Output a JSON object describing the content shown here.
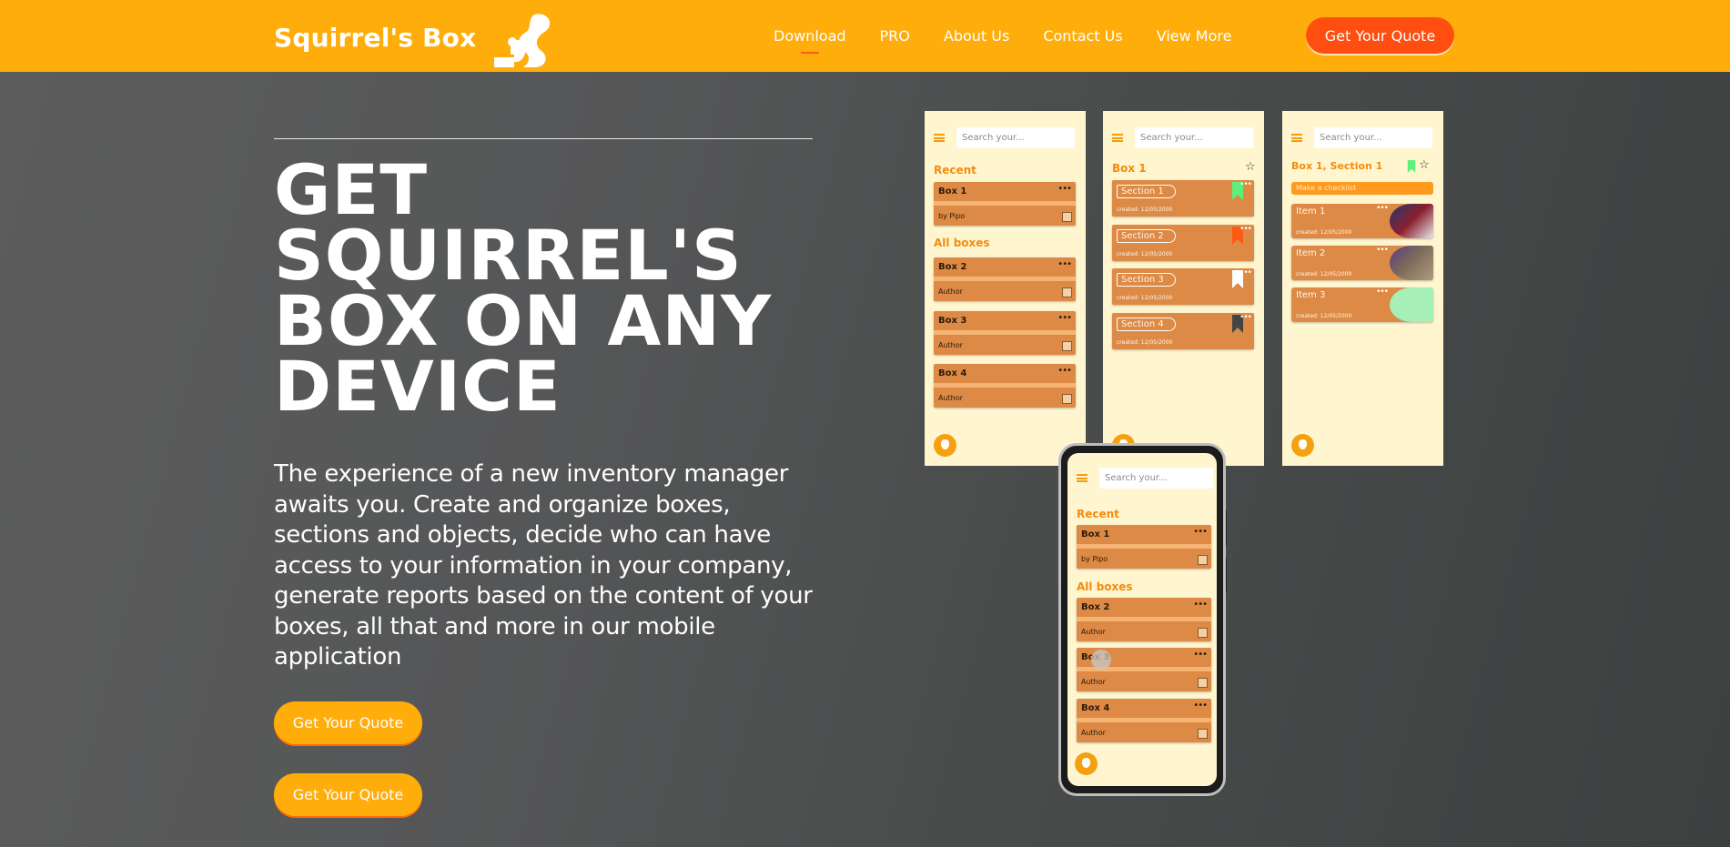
{
  "brand": {
    "name": "Squirrel's Box",
    "logo_icon": "squirrel-box-logo-icon"
  },
  "nav": {
    "items": [
      {
        "label": "Download",
        "active": true
      },
      {
        "label": "PRO",
        "active": false
      },
      {
        "label": "About Us",
        "active": false
      },
      {
        "label": "Contact Us",
        "active": false
      },
      {
        "label": "View More",
        "active": false
      }
    ],
    "cta_label": "Get Your Quote"
  },
  "hero": {
    "title": "GET SQUIRREL'S BOX ON ANY DEVICE",
    "description": "The experience of a new inventory manager awaits you. Create and organize boxes, sections and objects, decide who can have access to your information in your company, generate reports based on the content of your boxes, all that and more in our mobile application",
    "cta_primary": "Get Your Quote",
    "cta_secondary": "Get Your Quote"
  },
  "mockups": {
    "search_placeholder": "Search your...",
    "screen1": {
      "recent_title": "Recent",
      "all_title": "All boxes",
      "boxes": [
        {
          "name": "Box 1",
          "sub": "by Pipo"
        },
        {
          "name": "Box 2",
          "sub": "Author"
        },
        {
          "name": "Box 3",
          "sub": "Author"
        },
        {
          "name": "Box 4",
          "sub": "Author"
        }
      ]
    },
    "screen2": {
      "title": "Box 1",
      "sections": [
        {
          "label": "Section 1",
          "date": "created: 12/05/2000",
          "flag_color": "#5ef07a"
        },
        {
          "label": "Section 2",
          "date": "created: 12/05/2000",
          "flag_color": "#ff5a12"
        },
        {
          "label": "Section 3",
          "date": "created: 12/05/2000",
          "flag_color": "#ffffff"
        },
        {
          "label": "Section 4",
          "date": "created: 12/05/2000",
          "flag_color": "#444444"
        }
      ]
    },
    "screen3": {
      "title": "Box 1, Section 1",
      "checklist": "Make a checklist",
      "items": [
        {
          "label": "Item 1",
          "date": "created: 12/05/2000"
        },
        {
          "label": "Item 2",
          "date": "created: 12/05/2000"
        },
        {
          "label": "Item 3",
          "date": "created: 12/05/2000"
        }
      ]
    },
    "phone": {
      "recent_title": "Recent",
      "all_title": "All boxes",
      "boxes": [
        {
          "name": "Box 1",
          "sub": "by Pipo"
        },
        {
          "name": "Box 2",
          "sub": "Author"
        },
        {
          "name": "Box 3",
          "sub": "Author"
        },
        {
          "name": "Box 4",
          "sub": "Author"
        }
      ]
    }
  },
  "colors": {
    "header": "#ffad0b",
    "accent": "#ff4e0f",
    "card": "#dc8a45",
    "screen_bg": "#fff6d0"
  }
}
